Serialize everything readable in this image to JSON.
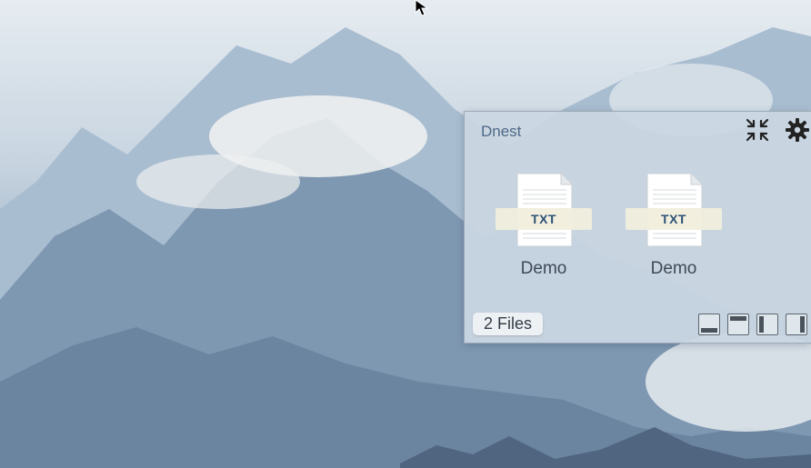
{
  "panel": {
    "title": "Dnest",
    "header_icons": [
      "collapse-icon",
      "gear-icon"
    ],
    "files": [
      {
        "type_label": "TXT",
        "name": "Demo"
      },
      {
        "type_label": "TXT",
        "name": "Demo"
      }
    ],
    "file_count_label": "2 Files",
    "dock_buttons": [
      "dock-bottom",
      "dock-top",
      "dock-left",
      "dock-right"
    ]
  },
  "colors": {
    "title": "#4e6a88",
    "badge_text": "#2d5276",
    "panel_bg": "#cad6e2"
  }
}
